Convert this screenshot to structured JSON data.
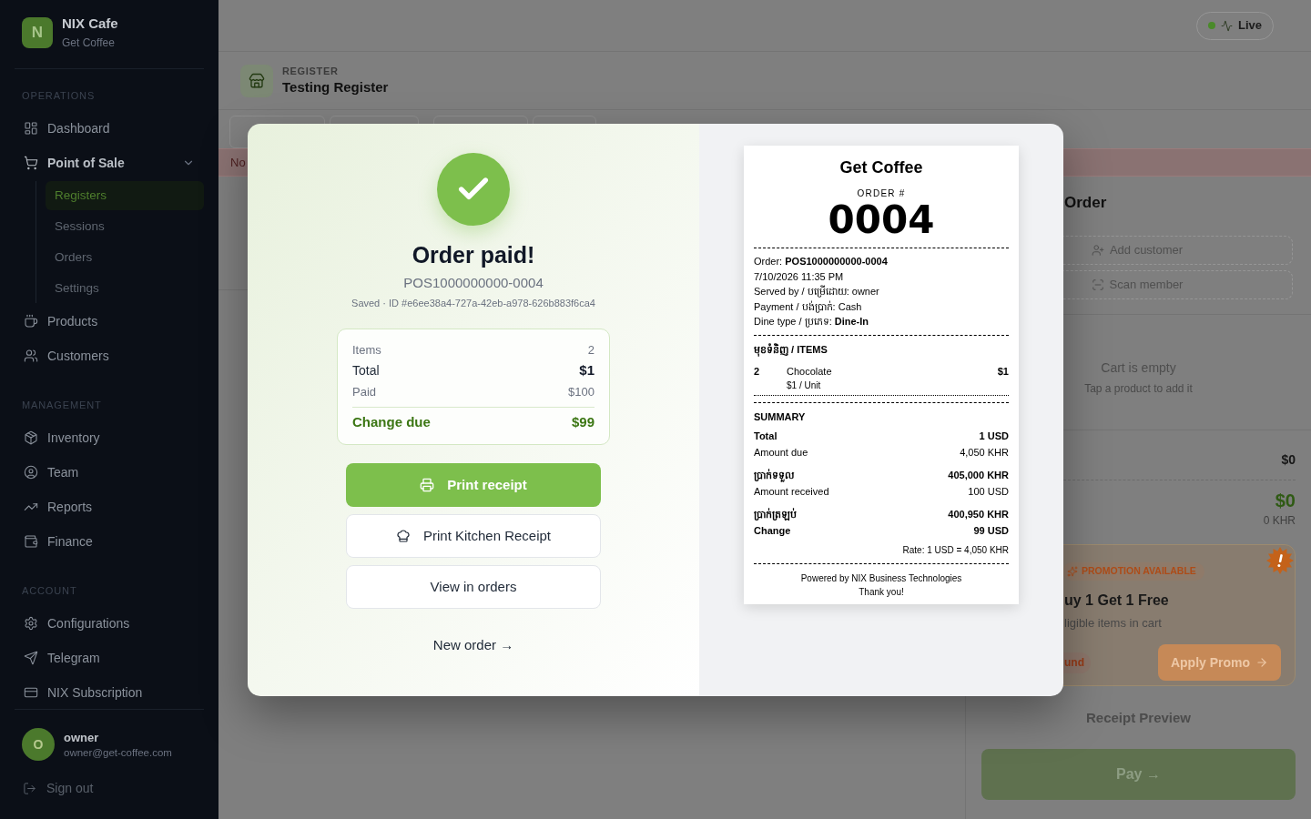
{
  "sidebar": {
    "brand": {
      "initial": "N",
      "name": "NIX Cafe",
      "subtitle": "Get Coffee"
    },
    "sections": [
      {
        "label": "OPERATIONS",
        "items": [
          {
            "label": "Dashboard",
            "selected": false
          },
          {
            "label": "Point of Sale",
            "selected": false,
            "expanded": true,
            "children": [
              {
                "label": "Registers",
                "selected": true
              },
              {
                "label": "Sessions",
                "selected": false
              },
              {
                "label": "Orders",
                "selected": false
              },
              {
                "label": "Settings",
                "selected": false
              }
            ]
          },
          {
            "label": "Products",
            "selected": false
          },
          {
            "label": "Customers",
            "selected": false
          }
        ]
      },
      {
        "label": "MANAGEMENT",
        "items": [
          {
            "label": "Inventory",
            "selected": false
          },
          {
            "label": "Team",
            "selected": false
          },
          {
            "label": "Reports",
            "selected": false
          },
          {
            "label": "Finance",
            "selected": false
          }
        ]
      },
      {
        "label": "ACCOUNT",
        "items": [
          {
            "label": "Configurations",
            "selected": false
          },
          {
            "label": "Telegram",
            "selected": false
          },
          {
            "label": "NIX Subscription",
            "selected": false
          }
        ]
      }
    ],
    "user": {
      "initial": "O",
      "name": "owner",
      "email": "owner@get-coffee.com"
    },
    "sign_out": "Sign out"
  },
  "header": {
    "status": {
      "label": "Live",
      "color": "#4a8a2a"
    }
  },
  "register": {
    "label": "REGISTER",
    "name": "Testing Register"
  },
  "banner": {
    "text": "No"
  },
  "order_panel": {
    "title": "Order",
    "actions": [
      "Add customer",
      "Scan member"
    ],
    "empty": {
      "title": "Cart is empty",
      "hint": "Tap a product to add it"
    },
    "subtotal": "$0",
    "total": "$0",
    "total_khr": "0 KHR",
    "promo": {
      "badge": "PROMOTION AVAILABLE",
      "title": "uy 1 Get 1 Free",
      "subtitle": "ligible items in cart",
      "tag": "und",
      "button": "Apply Promo"
    },
    "preview": "Receipt Preview",
    "pay": "Pay →"
  },
  "dialog": {
    "title": "Order paid!",
    "order_number": "POS1000000000-0004",
    "saved": "Saved · ID #e6ee38a4-727a-42eb-a978-626b883f6ca4",
    "summary": {
      "rows": [
        {
          "label": "Items",
          "value": "2",
          "kind": "muted"
        },
        {
          "label": "Total",
          "value": "$1",
          "kind": "total"
        },
        {
          "label": "Paid",
          "value": "$100",
          "kind": "muted"
        }
      ],
      "change": {
        "label": "Change due",
        "value": "$99"
      }
    },
    "buttons": [
      {
        "label": "Print receipt",
        "kind": "primary"
      },
      {
        "label": "Print Kitchen Receipt",
        "kind": "secondary"
      },
      {
        "label": "View in orders",
        "kind": "secondary"
      }
    ],
    "link": "New order →"
  },
  "receipt": {
    "shop": "Get Coffee",
    "order_label": "ORDER #",
    "order_no": "0004",
    "details": [
      "Order: **POS1000000000-0004**",
      "7/10/2026 11:35 PM",
      "Served by / បម្រើដោយ: owner",
      "Payment / បង់ប្រាក់: Cash",
      "Dine type / ប្រភេទ: **Dine-In**"
    ],
    "items_heading": "មុខទំនិញ / ITEMS",
    "items": [
      {
        "qty": "2",
        "name": "Chocolate",
        "unit": "$1 / Unit",
        "price": "$1"
      }
    ],
    "summary_heading": "SUMMARY",
    "groups": [
      {
        "rows": [
          {
            "label": "Total",
            "value": "1 USD",
            "bold": true
          },
          {
            "label": "Amount due",
            "value": "4,050 KHR",
            "bold": false
          }
        ]
      },
      {
        "rows": [
          {
            "label": "ប្រាក់ទទួល",
            "value": "405,000 KHR",
            "bold": true
          },
          {
            "label": "Amount received",
            "value": "100 USD",
            "bold": false
          }
        ]
      },
      {
        "rows": [
          {
            "label": "ប្រាក់ត្រឡប់",
            "value": "400,950 KHR",
            "bold": true
          },
          {
            "label": "Change",
            "value": "99 USD",
            "bold": true
          }
        ]
      }
    ],
    "rate": "Rate: 1 USD = 4,050 KHR",
    "footer": [
      "Powered by NIX Business Technologies",
      "Thank you!"
    ]
  }
}
